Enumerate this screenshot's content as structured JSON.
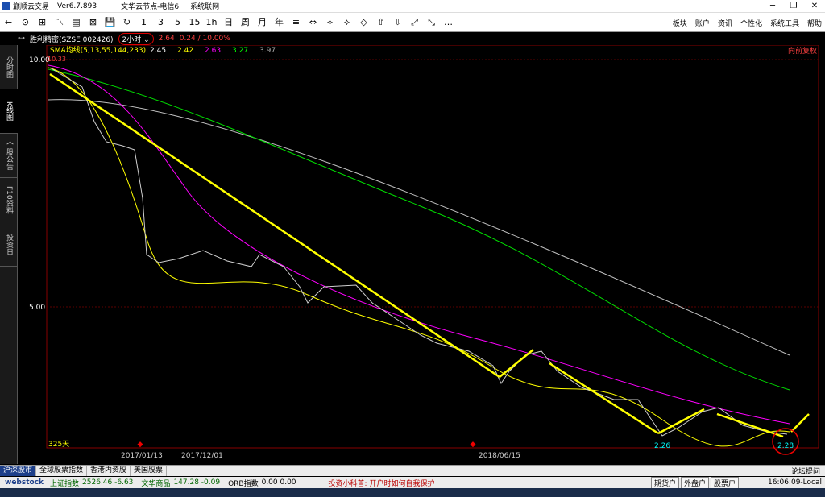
{
  "window": {
    "title_app": "巅顺云交易",
    "title_ver": "Ver6.7.893",
    "title_node": "文华云节点-电信6",
    "title_sys": "系统联网"
  },
  "toolbar": {
    "buttons": [
      "←",
      "⊙",
      "⊞",
      "〽",
      "▤",
      "⊠",
      "💾",
      "↻",
      "1",
      "3",
      "5",
      "15",
      "1h",
      "日",
      "周",
      "月",
      "年",
      "≡",
      "⇔",
      "⟡",
      "⟡",
      "◇",
      "⇧",
      "⇩",
      "⤢",
      "⤡",
      "…"
    ]
  },
  "menu": [
    "板块",
    "账户",
    "资讯",
    "个性化",
    "系统工具",
    "帮助"
  ],
  "sidetabs": [
    "分时图",
    "K线图",
    "个股公告",
    "F10资料",
    "投资日"
  ],
  "header": {
    "stock": "胜利精密(SZSE 002426)",
    "period": "2小时",
    "price": "2.64",
    "change": "0.24 / 10.00%",
    "fuquan": "向前复权"
  },
  "sma": {
    "label": "SMA均线(5,13,55,144,233)",
    "values": [
      "2.45",
      "2.42",
      "2.63",
      "3.27",
      "3.97"
    ],
    "colors": [
      "#ffffff",
      "#ffff00",
      "#ff00ff",
      "#00ff00",
      "#c0c0c0"
    ]
  },
  "chart_data": {
    "type": "line",
    "yticks": [
      "10.00",
      "5.00"
    ],
    "top_label": "10.33",
    "xticks": [
      "2017/01/13",
      "2017/12/01",
      "2018/06/15"
    ],
    "days": "325天",
    "low_labels": [
      "2.26",
      "2.28"
    ]
  },
  "bottomtabs": [
    "沪深股市",
    "全球股票指数",
    "香港内资股",
    "美国股票"
  ],
  "forum": "论坛提问",
  "status": {
    "sh_label": "上证指数",
    "sh_val": "2526.46 -6.63",
    "wh_label": "文华商品",
    "wh_val": "147.28 -0.09",
    "orb_label": "ORB指数",
    "orb_val": "0.00 0.00",
    "news": "投资小科普: 开户时如何自我保护",
    "btns": [
      "期货户",
      "外盘户",
      "股票户"
    ],
    "time": "16:06:09-Local"
  },
  "brand": "webstock"
}
